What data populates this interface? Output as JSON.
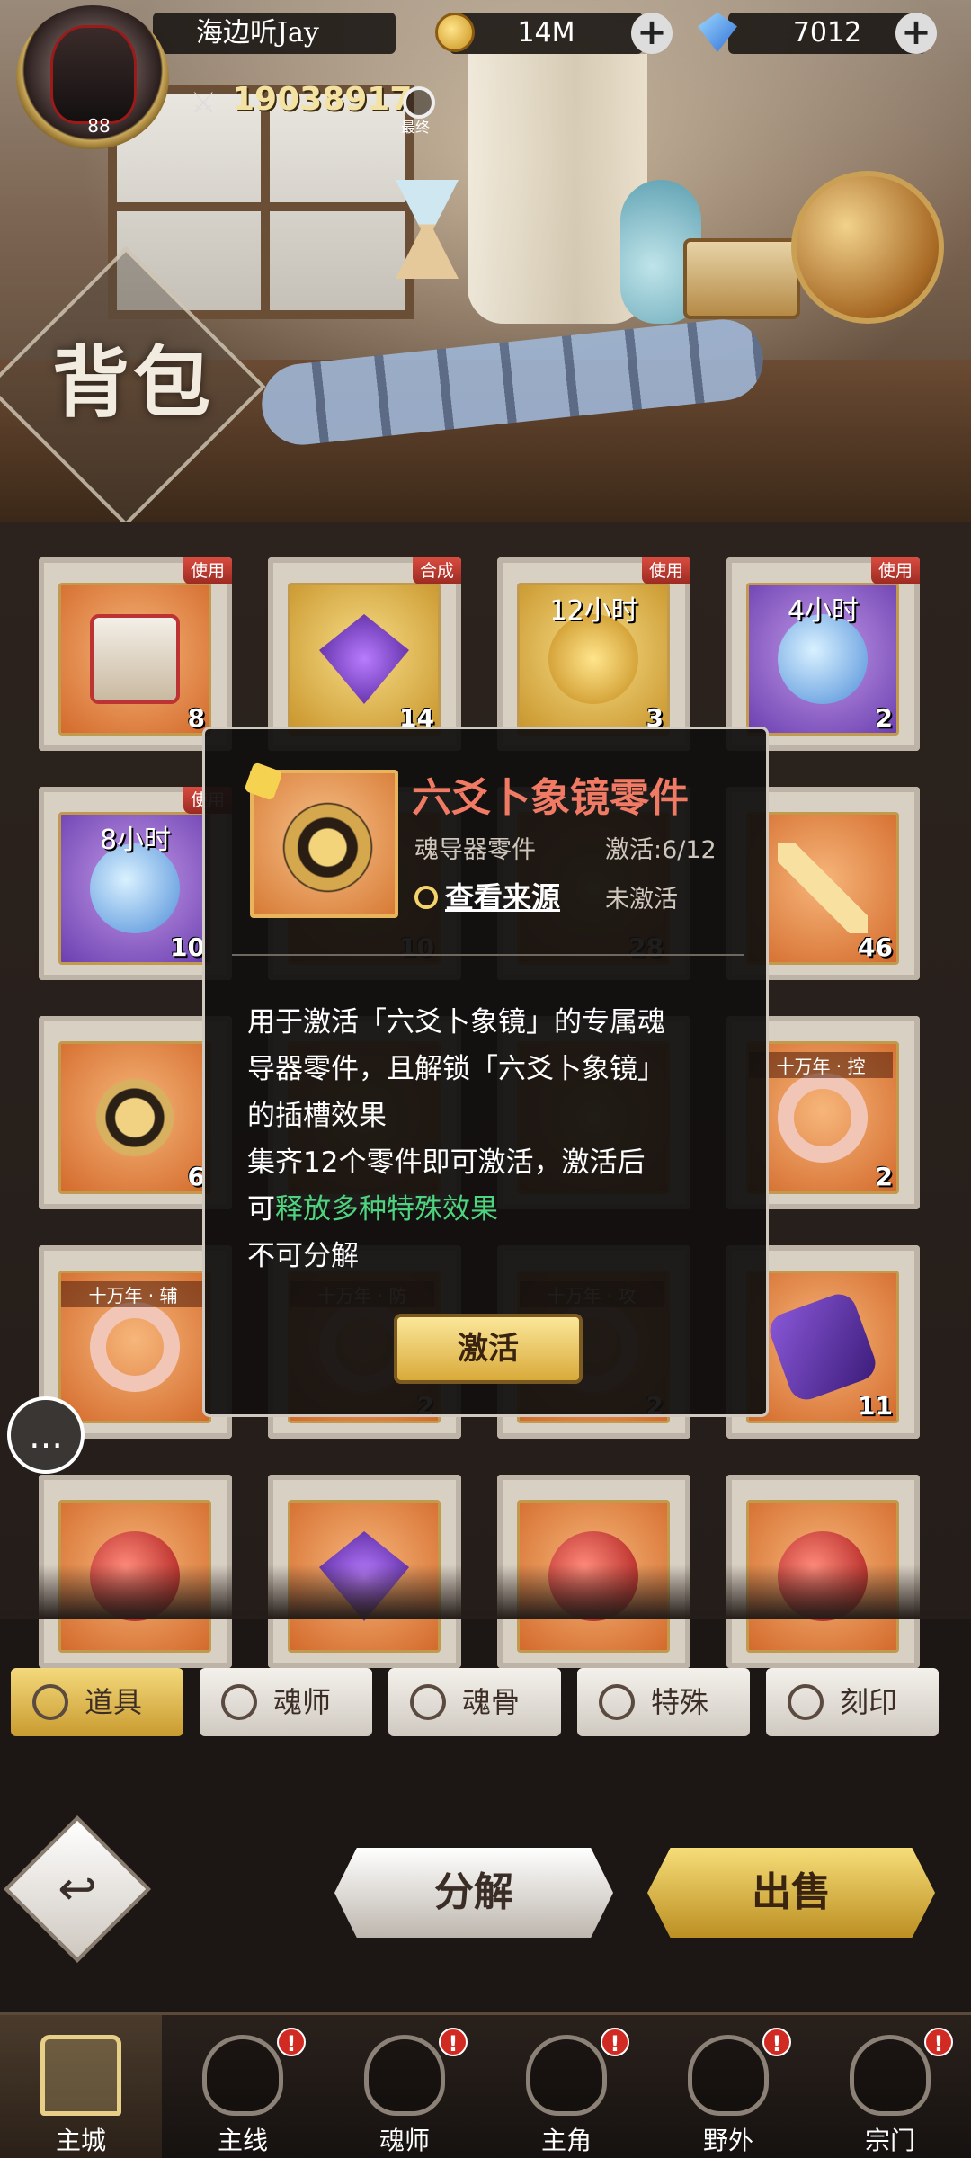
{
  "player": {
    "name": "海边听Jay",
    "level": "88",
    "power": "19038917",
    "search_caption": "最终"
  },
  "resources": {
    "gold": "14M",
    "diamonds": "7012"
  },
  "page_title": "背包",
  "grid": {
    "rows": [
      [
        {
          "tag": "使用",
          "count": "8",
          "time": "",
          "label": "",
          "rarity": "orange",
          "icon": "gift-box-icon"
        },
        {
          "tag": "合成",
          "count": "14",
          "time": "",
          "label": "",
          "rarity": "gold",
          "icon": "purple-gem-icon"
        },
        {
          "tag": "使用",
          "count": "3",
          "time": "12小时",
          "label": "",
          "rarity": "gold",
          "icon": "gold-coin-chest-icon"
        },
        {
          "tag": "使用",
          "count": "2",
          "time": "4小时",
          "label": "",
          "rarity": "purple",
          "icon": "potion-icon"
        }
      ],
      [
        {
          "tag": "使用",
          "count": "10",
          "time": "8小时",
          "label": "",
          "rarity": "purple",
          "icon": "potion-icon"
        },
        {
          "tag": "",
          "count": "10",
          "time": "",
          "label": "",
          "rarity": "orange",
          "icon": "item-icon"
        },
        {
          "tag": "",
          "count": "28",
          "time": "",
          "label": "",
          "rarity": "orange",
          "icon": "item-icon"
        },
        {
          "tag": "",
          "count": "46",
          "time": "",
          "label": "",
          "rarity": "orange",
          "icon": "sword-icon"
        }
      ],
      [
        {
          "tag": "",
          "count": "6",
          "time": "",
          "label": "",
          "rarity": "orange",
          "icon": "mirror-part-icon"
        },
        {
          "tag": "",
          "count": "",
          "time": "",
          "label": "",
          "rarity": "orange",
          "icon": "item-icon"
        },
        {
          "tag": "",
          "count": "",
          "time": "",
          "label": "",
          "rarity": "orange",
          "icon": "item-icon"
        },
        {
          "tag": "",
          "count": "2",
          "time": "",
          "label": "十万年 · 控",
          "rarity": "orange",
          "icon": "soul-ring-icon"
        }
      ],
      [
        {
          "tag": "",
          "count": "",
          "time": "",
          "label": "十万年 · 辅",
          "rarity": "orange",
          "icon": "soul-ring-icon"
        },
        {
          "tag": "",
          "count": "2",
          "time": "",
          "label": "十万年 · 防",
          "rarity": "orange",
          "icon": "soul-ring-icon"
        },
        {
          "tag": "",
          "count": "2",
          "time": "",
          "label": "十万年 · 攻",
          "rarity": "orange",
          "icon": "soul-ring-icon"
        },
        {
          "tag": "",
          "count": "11",
          "time": "",
          "label": "",
          "rarity": "orange",
          "icon": "scroll-icon"
        }
      ],
      [
        {
          "tag": "",
          "count": "",
          "time": "",
          "label": "",
          "rarity": "orange",
          "icon": "red-orb-icon"
        },
        {
          "tag": "",
          "count": "",
          "time": "",
          "label": "",
          "rarity": "orange",
          "icon": "purple-gem-icon"
        },
        {
          "tag": "",
          "count": "",
          "time": "",
          "label": "",
          "rarity": "orange",
          "icon": "red-orb-icon"
        },
        {
          "tag": "",
          "count": "",
          "time": "",
          "label": "",
          "rarity": "orange",
          "icon": "red-orb-icon"
        }
      ]
    ]
  },
  "tabs": [
    {
      "label": "道具",
      "active": true
    },
    {
      "label": "魂师",
      "active": false
    },
    {
      "label": "魂骨",
      "active": false
    },
    {
      "label": "特殊",
      "active": false
    },
    {
      "label": "刻印",
      "active": false
    }
  ],
  "actions": {
    "decompose": "分解",
    "sell": "出售"
  },
  "bottom_nav": [
    {
      "label": "主城",
      "badge": false,
      "active": true
    },
    {
      "label": "主线",
      "badge": true,
      "active": false
    },
    {
      "label": "魂师",
      "badge": true,
      "active": false
    },
    {
      "label": "主角",
      "badge": true,
      "active": false
    },
    {
      "label": "野外",
      "badge": true,
      "active": false
    },
    {
      "label": "宗门",
      "badge": true,
      "active": false
    }
  ],
  "popup": {
    "item_name": "六爻卜象镜零件",
    "item_type": "魂导器零件",
    "progress": "激活:6/12",
    "source_link": "查看来源",
    "status": "未激活",
    "description": {
      "line1": "用于激活「六爻卜象镜」的专属魂",
      "line2": "导器零件，且解锁「六爻卜象镜」",
      "line3": "的插槽效果",
      "line4": "集齐12个零件即可激活，激活后",
      "line5_prefix": "可",
      "line5_highlight": "释放多种特殊效果",
      "line6": "不可分解"
    },
    "button_label": "激活",
    "colors": {
      "title": "#f07a64",
      "highlight": "#4ed47f"
    }
  },
  "colors": {
    "accent_gold": "#f4d97c",
    "badge_red": "#d12a22"
  }
}
